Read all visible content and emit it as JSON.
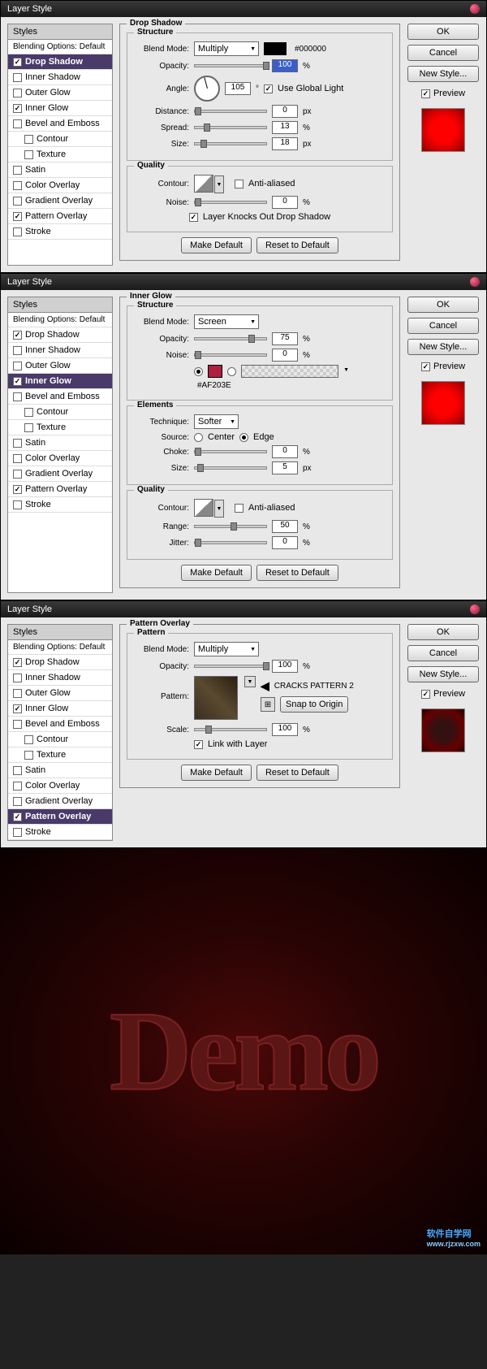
{
  "dialogs": [
    {
      "title": "Layer Style",
      "effect_title": "Drop Shadow",
      "styles_header": "Styles",
      "blending_default": "Blending Options: Default",
      "items": [
        {
          "label": "Drop Shadow",
          "checked": true,
          "active": true
        },
        {
          "label": "Inner Shadow",
          "checked": false
        },
        {
          "label": "Outer Glow",
          "checked": false
        },
        {
          "label": "Inner Glow",
          "checked": true
        },
        {
          "label": "Bevel and Emboss",
          "checked": false
        },
        {
          "label": "Contour",
          "checked": false,
          "indent": true
        },
        {
          "label": "Texture",
          "checked": false,
          "indent": true
        },
        {
          "label": "Satin",
          "checked": false
        },
        {
          "label": "Color Overlay",
          "checked": false
        },
        {
          "label": "Gradient Overlay",
          "checked": false
        },
        {
          "label": "Pattern Overlay",
          "checked": true
        },
        {
          "label": "Stroke",
          "checked": false
        }
      ],
      "structure": {
        "title": "Structure",
        "blend_mode_label": "Blend Mode:",
        "blend_mode": "Multiply",
        "color_hex": "#000000",
        "opacity_label": "Opacity:",
        "opacity": "100",
        "angle_label": "Angle:",
        "angle": "105",
        "use_global": "Use Global Light",
        "distance_label": "Distance:",
        "distance": "0",
        "spread_label": "Spread:",
        "spread": "13",
        "size_label": "Size:",
        "size": "18"
      },
      "quality": {
        "title": "Quality",
        "contour_label": "Contour:",
        "anti_aliased": "Anti-aliased",
        "noise_label": "Noise:",
        "noise": "0",
        "knockout": "Layer Knocks Out Drop Shadow"
      },
      "make_default": "Make Default",
      "reset_default": "Reset to Default",
      "buttons": {
        "ok": "OK",
        "cancel": "Cancel",
        "new_style": "New Style...",
        "preview": "Preview"
      }
    },
    {
      "title": "Layer Style",
      "effect_title": "Inner Glow",
      "styles_header": "Styles",
      "blending_default": "Blending Options: Default",
      "items": [
        {
          "label": "Drop Shadow",
          "checked": true
        },
        {
          "label": "Inner Shadow",
          "checked": false
        },
        {
          "label": "Outer Glow",
          "checked": false
        },
        {
          "label": "Inner Glow",
          "checked": true,
          "active": true
        },
        {
          "label": "Bevel and Emboss",
          "checked": false
        },
        {
          "label": "Contour",
          "checked": false,
          "indent": true
        },
        {
          "label": "Texture",
          "checked": false,
          "indent": true
        },
        {
          "label": "Satin",
          "checked": false
        },
        {
          "label": "Color Overlay",
          "checked": false
        },
        {
          "label": "Gradient Overlay",
          "checked": false
        },
        {
          "label": "Pattern Overlay",
          "checked": true
        },
        {
          "label": "Stroke",
          "checked": false
        }
      ],
      "structure": {
        "title": "Structure",
        "blend_mode_label": "Blend Mode:",
        "blend_mode": "Screen",
        "opacity_label": "Opacity:",
        "opacity": "75",
        "noise_label": "Noise:",
        "noise": "0",
        "color_hex": "#AF203E"
      },
      "elements": {
        "title": "Elements",
        "technique_label": "Technique:",
        "technique": "Softer",
        "source_label": "Source:",
        "center": "Center",
        "edge": "Edge",
        "choke_label": "Choke:",
        "choke": "0",
        "size_label": "Size:",
        "size": "5"
      },
      "quality": {
        "title": "Quality",
        "contour_label": "Contour:",
        "anti_aliased": "Anti-aliased",
        "range_label": "Range:",
        "range": "50",
        "jitter_label": "Jitter:",
        "jitter": "0"
      },
      "make_default": "Make Default",
      "reset_default": "Reset to Default",
      "buttons": {
        "ok": "OK",
        "cancel": "Cancel",
        "new_style": "New Style...",
        "preview": "Preview"
      }
    },
    {
      "title": "Layer Style",
      "effect_title": "Pattern Overlay",
      "styles_header": "Styles",
      "blending_default": "Blending Options: Default",
      "items": [
        {
          "label": "Drop Shadow",
          "checked": true
        },
        {
          "label": "Inner Shadow",
          "checked": false
        },
        {
          "label": "Outer Glow",
          "checked": false
        },
        {
          "label": "Inner Glow",
          "checked": true
        },
        {
          "label": "Bevel and Emboss",
          "checked": false
        },
        {
          "label": "Contour",
          "checked": false,
          "indent": true
        },
        {
          "label": "Texture",
          "checked": false,
          "indent": true
        },
        {
          "label": "Satin",
          "checked": false
        },
        {
          "label": "Color Overlay",
          "checked": false
        },
        {
          "label": "Gradient Overlay",
          "checked": false
        },
        {
          "label": "Pattern Overlay",
          "checked": true,
          "active": true
        },
        {
          "label": "Stroke",
          "checked": false
        }
      ],
      "pattern": {
        "title": "Pattern",
        "blend_mode_label": "Blend Mode:",
        "blend_mode": "Multiply",
        "opacity_label": "Opacity:",
        "opacity": "100",
        "pattern_label": "Pattern:",
        "annotation": "CRACKS PATTERN 2",
        "snap_origin": "Snap to Origin",
        "scale_label": "Scale:",
        "scale": "100",
        "link_layer": "Link with Layer"
      },
      "make_default": "Make Default",
      "reset_default": "Reset to Default",
      "buttons": {
        "ok": "OK",
        "cancel": "Cancel",
        "new_style": "New Style...",
        "preview": "Preview"
      }
    }
  ],
  "units": {
    "pct": "%",
    "px": "px",
    "deg": "°"
  },
  "result_text": "Demo",
  "watermark": {
    "main": "软件自学网",
    "sub": "www.rjzxw.com"
  }
}
